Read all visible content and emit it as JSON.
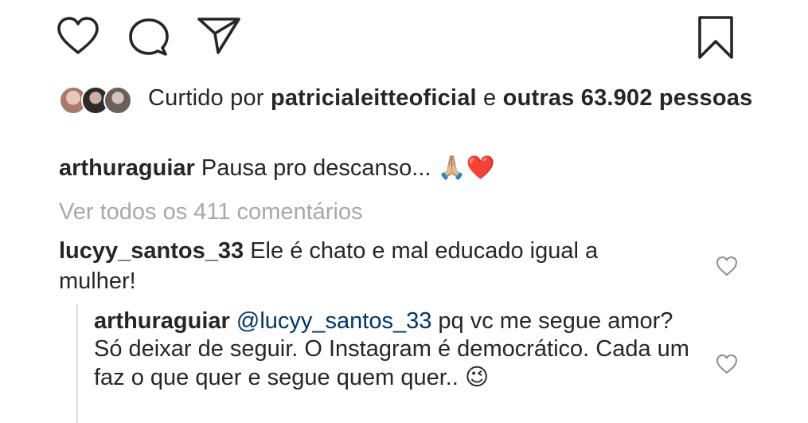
{
  "actions": {
    "like_icon": "heart-outline-icon",
    "comment_icon": "speech-bubble-icon",
    "share_icon": "paper-plane-icon",
    "save_icon": "bookmark-icon"
  },
  "likes": {
    "prefix": "Curtido por",
    "username": "patricialeitteoficial",
    "connector": "e",
    "others": "outras 63.902",
    "suffix": "pessoas"
  },
  "caption": {
    "username": "arthuraguiar",
    "text": "Pausa pro descanso...",
    "emoji": "🙏🏼❤️"
  },
  "view_all_comments": "Ver todos os 411 comentários",
  "comments": [
    {
      "username": "lucyy_santos_33",
      "text": "Ele é chato e mal educado igual a mulher!"
    }
  ],
  "replies": [
    {
      "username": "arthuraguiar",
      "mention": "@lucyy_santos_33",
      "text": "pq vc me segue amor? Só deixar de seguir. O Instagram é democrático. Cada um faz o que quer e segue quem quer..",
      "emoji": "😉"
    }
  ],
  "colors": {
    "text": "#262626",
    "muted": "#a8a8a8",
    "mention": "#003569"
  }
}
